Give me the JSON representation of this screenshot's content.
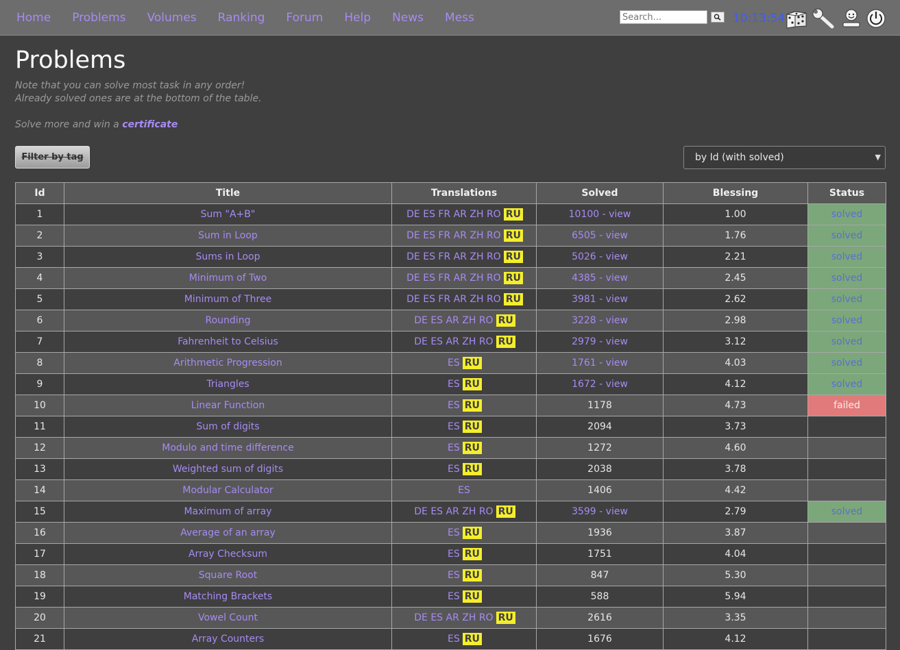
{
  "nav": {
    "items": [
      {
        "label": "Home"
      },
      {
        "label": "Problems"
      },
      {
        "label": "Volumes"
      },
      {
        "label": "Ranking"
      },
      {
        "label": "Forum"
      },
      {
        "label": "Help"
      },
      {
        "label": "News"
      },
      {
        "label": "Mess"
      }
    ],
    "search_placeholder": "Search...",
    "clock": "10:13:54",
    "icons": [
      "dice-icon",
      "wrench-icon",
      "user-icon",
      "power-icon"
    ]
  },
  "page": {
    "title": "Problems",
    "note_line1": "Note that you can solve most task in any order!",
    "note_line2": "Already solved ones are at the bottom of the table.",
    "certificate_prefix": "Solve more and win a ",
    "certificate_link": "certificate",
    "filter_label": "Filter by tag",
    "sort_value": "by Id (with solved)"
  },
  "colors": {
    "link": "#a78bf2",
    "solved_bg": "#7ba77b",
    "failed_bg": "#e17b7b",
    "ru_badge": "#f4ee2b",
    "clock": "#3f5df2"
  },
  "table": {
    "headers": [
      "Id",
      "Title",
      "Translations",
      "Solved",
      "Blessing",
      "Status"
    ],
    "rows": [
      {
        "id": "1",
        "title": "Sum \"A+B\"",
        "langs": "DE ES FR AR ZH RO",
        "ru": true,
        "solved": "10100 - view",
        "solved_link": true,
        "blessing": "1.00",
        "status": "solved"
      },
      {
        "id": "2",
        "title": "Sum in Loop",
        "langs": "DE ES FR AR ZH RO",
        "ru": true,
        "solved": "6505 - view",
        "solved_link": true,
        "blessing": "1.76",
        "status": "solved"
      },
      {
        "id": "3",
        "title": "Sums in Loop",
        "langs": "DE ES FR AR ZH RO",
        "ru": true,
        "solved": "5026 - view",
        "solved_link": true,
        "blessing": "2.21",
        "status": "solved"
      },
      {
        "id": "4",
        "title": "Minimum of Two",
        "langs": "DE ES FR AR ZH RO",
        "ru": true,
        "solved": "4385 - view",
        "solved_link": true,
        "blessing": "2.45",
        "status": "solved"
      },
      {
        "id": "5",
        "title": "Minimum of Three",
        "langs": "DE ES FR AR ZH RO",
        "ru": true,
        "solved": "3981 - view",
        "solved_link": true,
        "blessing": "2.62",
        "status": "solved"
      },
      {
        "id": "6",
        "title": "Rounding",
        "langs": "DE ES AR ZH RO",
        "ru": true,
        "solved": "3228 - view",
        "solved_link": true,
        "blessing": "2.98",
        "status": "solved"
      },
      {
        "id": "7",
        "title": "Fahrenheit to Celsius",
        "langs": "DE ES AR ZH RO",
        "ru": true,
        "solved": "2979 - view",
        "solved_link": true,
        "blessing": "3.12",
        "status": "solved"
      },
      {
        "id": "8",
        "title": "Arithmetic Progression",
        "langs": "ES",
        "ru": true,
        "solved": "1761 - view",
        "solved_link": true,
        "blessing": "4.03",
        "status": "solved"
      },
      {
        "id": "9",
        "title": "Triangles",
        "langs": "ES",
        "ru": true,
        "solved": "1672 - view",
        "solved_link": true,
        "blessing": "4.12",
        "status": "solved"
      },
      {
        "id": "10",
        "title": "Linear Function",
        "langs": "ES",
        "ru": true,
        "solved": "1178",
        "solved_link": false,
        "blessing": "4.73",
        "status": "failed"
      },
      {
        "id": "11",
        "title": "Sum of digits",
        "langs": "ES",
        "ru": true,
        "solved": "2094",
        "solved_link": false,
        "blessing": "3.73",
        "status": ""
      },
      {
        "id": "12",
        "title": "Modulo and time difference",
        "langs": "ES",
        "ru": true,
        "solved": "1272",
        "solved_link": false,
        "blessing": "4.60",
        "status": ""
      },
      {
        "id": "13",
        "title": "Weighted sum of digits",
        "langs": "ES",
        "ru": true,
        "solved": "2038",
        "solved_link": false,
        "blessing": "3.78",
        "status": ""
      },
      {
        "id": "14",
        "title": "Modular Calculator",
        "langs": "ES",
        "ru": false,
        "solved": "1406",
        "solved_link": false,
        "blessing": "4.42",
        "status": ""
      },
      {
        "id": "15",
        "title": "Maximum of array",
        "langs": "DE ES AR ZH RO",
        "ru": true,
        "solved": "3599 - view",
        "solved_link": true,
        "blessing": "2.79",
        "status": "solved"
      },
      {
        "id": "16",
        "title": "Average of an array",
        "langs": "ES",
        "ru": true,
        "solved": "1936",
        "solved_link": false,
        "blessing": "3.87",
        "status": ""
      },
      {
        "id": "17",
        "title": "Array Checksum",
        "langs": "ES",
        "ru": true,
        "solved": "1751",
        "solved_link": false,
        "blessing": "4.04",
        "status": ""
      },
      {
        "id": "18",
        "title": "Square Root",
        "langs": "ES",
        "ru": true,
        "solved": "847",
        "solved_link": false,
        "blessing": "5.30",
        "status": ""
      },
      {
        "id": "19",
        "title": "Matching Brackets",
        "langs": "ES",
        "ru": true,
        "solved": "588",
        "solved_link": false,
        "blessing": "5.94",
        "status": ""
      },
      {
        "id": "20",
        "title": "Vowel Count",
        "langs": "DE ES AR ZH RO",
        "ru": true,
        "solved": "2616",
        "solved_link": false,
        "blessing": "3.35",
        "status": ""
      },
      {
        "id": "21",
        "title": "Array Counters",
        "langs": "ES",
        "ru": true,
        "solved": "1676",
        "solved_link": false,
        "blessing": "4.12",
        "status": ""
      }
    ],
    "ru_label": "RU"
  }
}
